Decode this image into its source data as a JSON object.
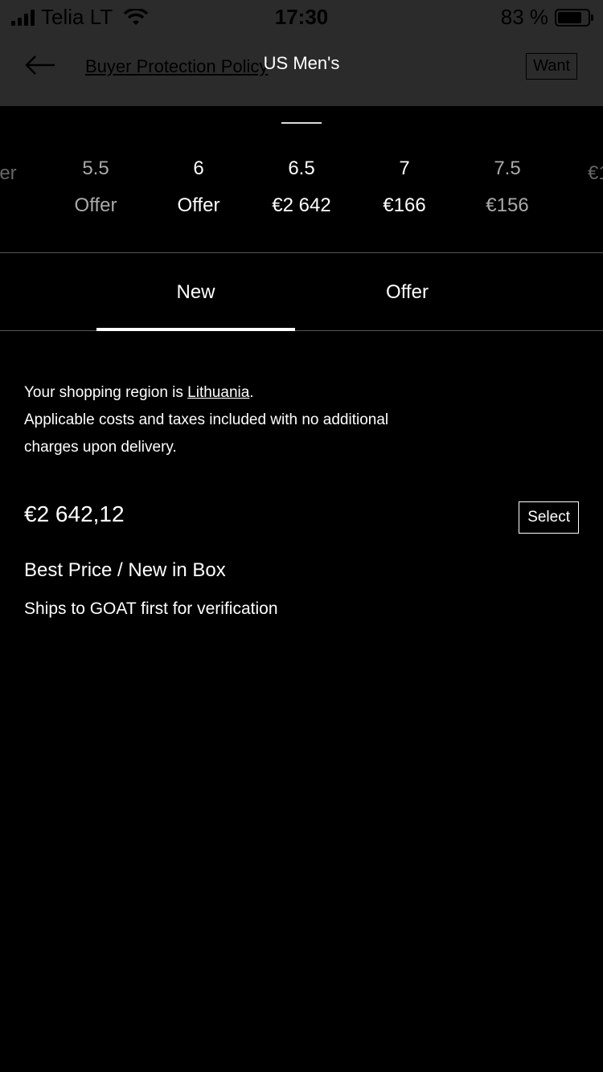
{
  "status": {
    "carrier": "Telia LT",
    "time": "17:30",
    "battery_pct": "83 %",
    "battery_level": 0.83
  },
  "nav": {
    "policy_link": "Buyer Protection Policy",
    "title": "US Men's",
    "want_label": "Want"
  },
  "sizes": [
    {
      "size": "",
      "price": "er"
    },
    {
      "size": "5.5",
      "price": "Offer"
    },
    {
      "size": "6",
      "price": "Offer"
    },
    {
      "size": "6.5",
      "price": "€2 642"
    },
    {
      "size": "7",
      "price": "€166"
    },
    {
      "size": "7.5",
      "price": "€156"
    },
    {
      "size": "",
      "price": "€1"
    }
  ],
  "tabs": {
    "new_label": "New",
    "offer_label": "Offer",
    "active": "New"
  },
  "notice": {
    "line1_prefix": "Your shopping region is ",
    "region": "Lithuania",
    "line1_suffix": ".",
    "line2": "Applicable costs and taxes included with no additional charges upon delivery."
  },
  "listing": {
    "price": "€2 642,12",
    "select_label": "Select",
    "condition": "Best Price / New in Box",
    "shipping": "Ships to GOAT first for verification"
  }
}
